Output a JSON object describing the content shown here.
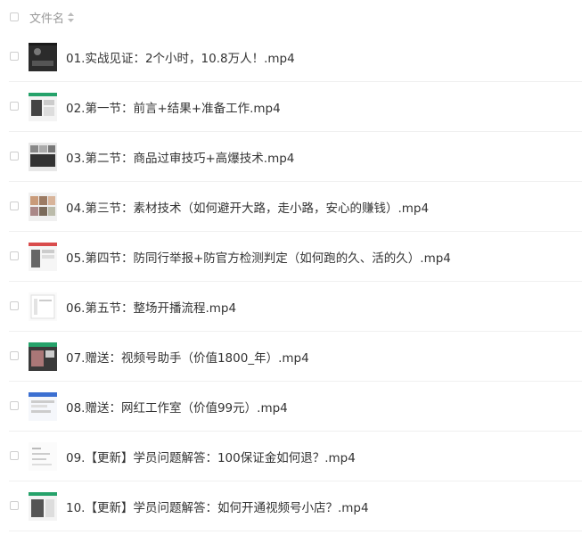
{
  "header": {
    "column_label": "文件名"
  },
  "files": [
    {
      "name": "01.实战见证：2个小时，10.8万人！.mp4",
      "thumb": "dark"
    },
    {
      "name": "02.第一节：前言+结果+准备工作.mp4",
      "thumb": "green"
    },
    {
      "name": "03.第二节：商品过审技巧+高爆技术.mp4",
      "thumb": "grid"
    },
    {
      "name": "04.第三节：素材技术（如何避开大路，走小路，安心的赚钱）.mp4",
      "thumb": "photos"
    },
    {
      "name": "05.第四节：防同行举报+防官方检测判定（如何跑的久、活的久）.mp4",
      "thumb": "red"
    },
    {
      "name": "06.第五节：整场开播流程.mp4",
      "thumb": "white"
    },
    {
      "name": "07.赠送：视频号助手（价值1800_年）.mp4",
      "thumb": "dark2"
    },
    {
      "name": "08.赠送：网红工作室（价值99元）.mp4",
      "thumb": "blue"
    },
    {
      "name": "09.【更新】学员问题解答：100保证金如何退？.mp4",
      "thumb": "white2"
    },
    {
      "name": "10.【更新】学员问题解答：如何开通视频号小店？.mp4",
      "thumb": "green2"
    }
  ]
}
